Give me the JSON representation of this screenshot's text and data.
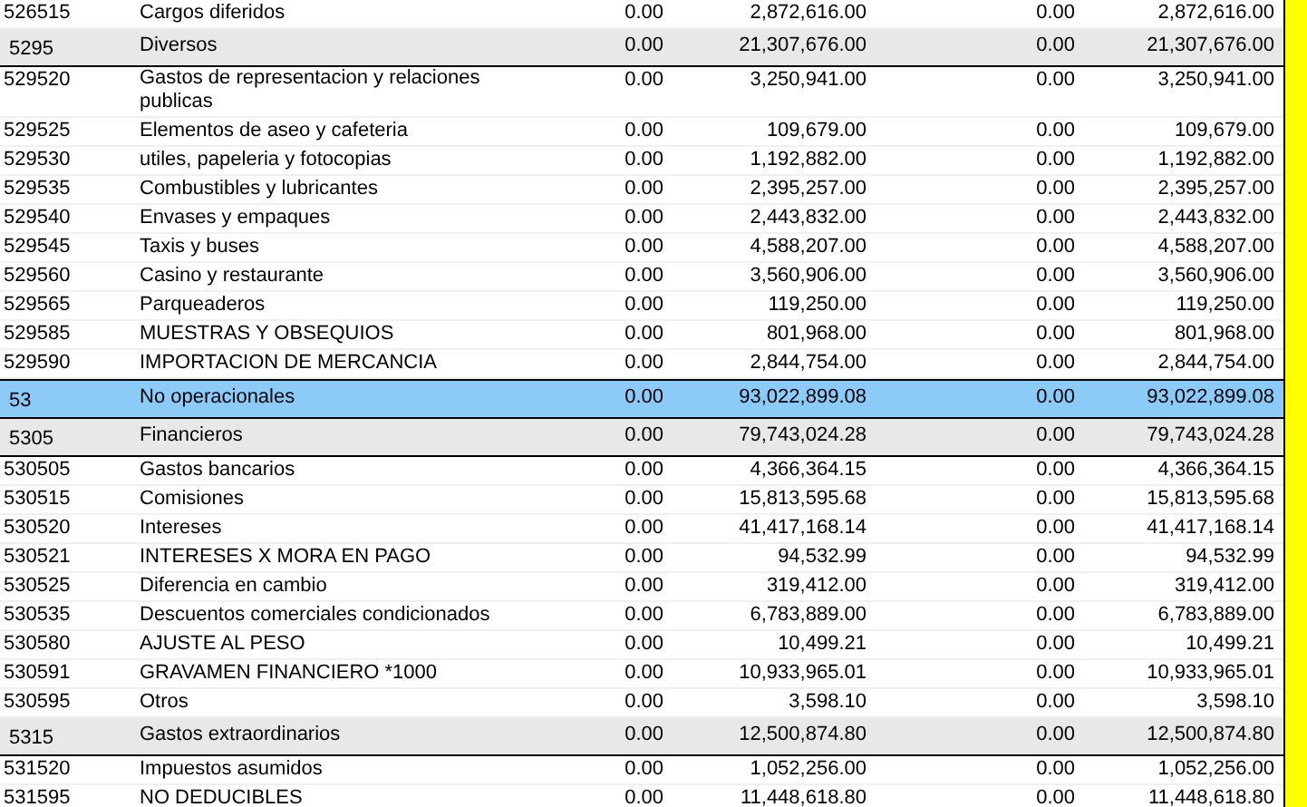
{
  "table": {
    "rows": [
      {
        "kind": "detail",
        "selected": false,
        "code": "526515",
        "name": "Cargos diferidos",
        "column_3": "0.00",
        "column_4": "2,872,616.00",
        "column_5": "0.00",
        "column_6": "2,872,616.00"
      },
      {
        "kind": "group",
        "selected": false,
        "code": "5295",
        "name": "Diversos",
        "column_3": "0.00",
        "column_4": "21,307,676.00",
        "column_5": "0.00",
        "column_6": "21,307,676.00"
      },
      {
        "kind": "detail",
        "selected": false,
        "code": "529520",
        "name": "Gastos de representacion y relaciones publicas",
        "column_3": "0.00",
        "column_4": "3,250,941.00",
        "column_5": "0.00",
        "column_6": "3,250,941.00"
      },
      {
        "kind": "detail",
        "selected": false,
        "code": "529525",
        "name": "Elementos de aseo y cafeteria",
        "column_3": "0.00",
        "column_4": "109,679.00",
        "column_5": "0.00",
        "column_6": "109,679.00"
      },
      {
        "kind": "detail",
        "selected": false,
        "code": "529530",
        "name": "utiles, papeleria y fotocopias",
        "column_3": "0.00",
        "column_4": "1,192,882.00",
        "column_5": "0.00",
        "column_6": "1,192,882.00"
      },
      {
        "kind": "detail",
        "selected": false,
        "code": "529535",
        "name": "Combustibles y lubricantes",
        "column_3": "0.00",
        "column_4": "2,395,257.00",
        "column_5": "0.00",
        "column_6": "2,395,257.00"
      },
      {
        "kind": "detail",
        "selected": false,
        "code": "529540",
        "name": "Envases y empaques",
        "column_3": "0.00",
        "column_4": "2,443,832.00",
        "column_5": "0.00",
        "column_6": "2,443,832.00"
      },
      {
        "kind": "detail",
        "selected": false,
        "code": "529545",
        "name": "Taxis y buses",
        "column_3": "0.00",
        "column_4": "4,588,207.00",
        "column_5": "0.00",
        "column_6": "4,588,207.00"
      },
      {
        "kind": "detail",
        "selected": false,
        "code": "529560",
        "name": "Casino y restaurante",
        "column_3": "0.00",
        "column_4": "3,560,906.00",
        "column_5": "0.00",
        "column_6": "3,560,906.00"
      },
      {
        "kind": "detail",
        "selected": false,
        "code": "529565",
        "name": "Parqueaderos",
        "column_3": "0.00",
        "column_4": "119,250.00",
        "column_5": "0.00",
        "column_6": "119,250.00"
      },
      {
        "kind": "detail",
        "selected": false,
        "code": "529585",
        "name": "MUESTRAS Y OBSEQUIOS",
        "column_3": "0.00",
        "column_4": "801,968.00",
        "column_5": "0.00",
        "column_6": "801,968.00"
      },
      {
        "kind": "detail",
        "selected": false,
        "code": "529590",
        "name": "IMPORTACION DE MERCANCIA",
        "column_3": "0.00",
        "column_4": "2,844,754.00",
        "column_5": "0.00",
        "column_6": "2,844,754.00"
      },
      {
        "kind": "group",
        "selected": true,
        "code": "53",
        "name": "No operacionales",
        "column_3": "0.00",
        "column_4": "93,022,899.08",
        "column_5": "0.00",
        "column_6": "93,022,899.08"
      },
      {
        "kind": "group",
        "selected": false,
        "code": "5305",
        "name": "Financieros",
        "column_3": "0.00",
        "column_4": "79,743,024.28",
        "column_5": "0.00",
        "column_6": "79,743,024.28"
      },
      {
        "kind": "detail",
        "selected": false,
        "code": "530505",
        "name": "Gastos bancarios",
        "column_3": "0.00",
        "column_4": "4,366,364.15",
        "column_5": "0.00",
        "column_6": "4,366,364.15"
      },
      {
        "kind": "detail",
        "selected": false,
        "code": "530515",
        "name": "Comisiones",
        "column_3": "0.00",
        "column_4": "15,813,595.68",
        "column_5": "0.00",
        "column_6": "15,813,595.68"
      },
      {
        "kind": "detail",
        "selected": false,
        "code": "530520",
        "name": "Intereses",
        "column_3": "0.00",
        "column_4": "41,417,168.14",
        "column_5": "0.00",
        "column_6": "41,417,168.14"
      },
      {
        "kind": "detail",
        "selected": false,
        "code": "530521",
        "name": "INTERESES X MORA EN PAGO",
        "column_3": "0.00",
        "column_4": "94,532.99",
        "column_5": "0.00",
        "column_6": "94,532.99"
      },
      {
        "kind": "detail",
        "selected": false,
        "code": "530525",
        "name": "Diferencia en cambio",
        "column_3": "0.00",
        "column_4": "319,412.00",
        "column_5": "0.00",
        "column_6": "319,412.00"
      },
      {
        "kind": "detail",
        "selected": false,
        "code": "530535",
        "name": "Descuentos comerciales condicionados",
        "column_3": "0.00",
        "column_4": "6,783,889.00",
        "column_5": "0.00",
        "column_6": "6,783,889.00"
      },
      {
        "kind": "detail",
        "selected": false,
        "code": "530580",
        "name": "AJUSTE AL PESO",
        "column_3": "0.00",
        "column_4": "10,499.21",
        "column_5": "0.00",
        "column_6": "10,499.21"
      },
      {
        "kind": "detail",
        "selected": false,
        "code": "530591",
        "name": "GRAVAMEN FINANCIERO *1000",
        "column_3": "0.00",
        "column_4": "10,933,965.01",
        "column_5": "0.00",
        "column_6": "10,933,965.01"
      },
      {
        "kind": "detail",
        "selected": false,
        "code": "530595",
        "name": "Otros",
        "column_3": "0.00",
        "column_4": "3,598.10",
        "column_5": "0.00",
        "column_6": "3,598.10"
      },
      {
        "kind": "group",
        "selected": false,
        "code": "5315",
        "name": "Gastos extraordinarios",
        "column_3": "0.00",
        "column_4": "12,500,874.80",
        "column_5": "0.00",
        "column_6": "12,500,874.80"
      },
      {
        "kind": "detail",
        "selected": false,
        "code": "531520",
        "name": "Impuestos asumidos",
        "column_3": "0.00",
        "column_4": "1,052,256.00",
        "column_5": "0.00",
        "column_6": "1,052,256.00"
      },
      {
        "kind": "detail",
        "selected": false,
        "code": "531595",
        "name": "NO DEDUCIBLES",
        "column_3": "0.00",
        "column_4": "11,448,618.80",
        "column_5": "0.00",
        "column_6": "11,448,618.80"
      }
    ]
  }
}
